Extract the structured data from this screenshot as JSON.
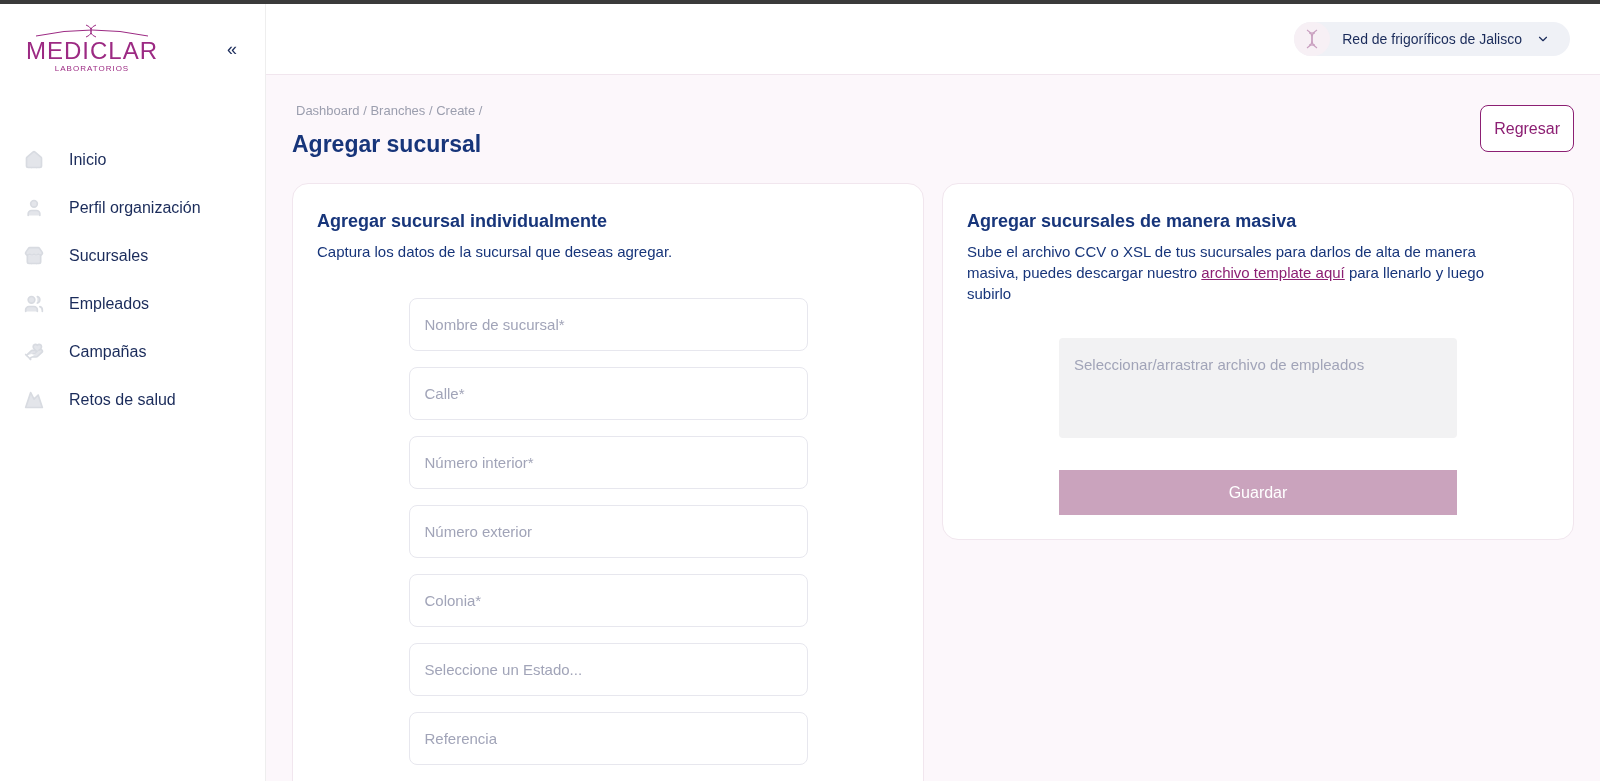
{
  "logo": {
    "name": "MEDICLAR",
    "subtitle": "LABORATORIOS"
  },
  "sidebar": {
    "collapse_icon": "«",
    "items": [
      {
        "label": "Inicio"
      },
      {
        "label": "Perfil organización"
      },
      {
        "label": "Sucursales"
      },
      {
        "label": "Empleados"
      },
      {
        "label": "Campañas"
      },
      {
        "label": "Retos de salud"
      }
    ]
  },
  "header": {
    "organization": "Red de frigoríficos de Jalisco"
  },
  "breadcrumb": "Dashboard / Branches / Create /",
  "page_title": "Agregar sucursal",
  "back_button": "Regresar",
  "individual": {
    "title": "Agregar sucursal individualmente",
    "subtitle": "Captura los datos de la sucursal que deseas agregar.",
    "fields": [
      {
        "placeholder": "Nombre de sucursal*"
      },
      {
        "placeholder": "Calle*"
      },
      {
        "placeholder": "Número interior*"
      },
      {
        "placeholder": "Número exterior"
      },
      {
        "placeholder": "Colonia*"
      },
      {
        "placeholder": "Seleccione un Estado..."
      },
      {
        "placeholder": "Referencia"
      }
    ]
  },
  "bulk": {
    "title": "Agregar sucursales de manera masiva",
    "text_before": "Sube el archivo CCV o XSL de tus sucursales para darlos de alta de manera masiva, puedes descargar nuestro",
    "link": "archivo template aquí",
    "text_after": "para llenarlo y luego subirlo",
    "dropzone": "Seleccionar/arrastrar archivo de empleados",
    "save_button": {
      "label": "Guardar",
      "disabled": true
    }
  }
}
